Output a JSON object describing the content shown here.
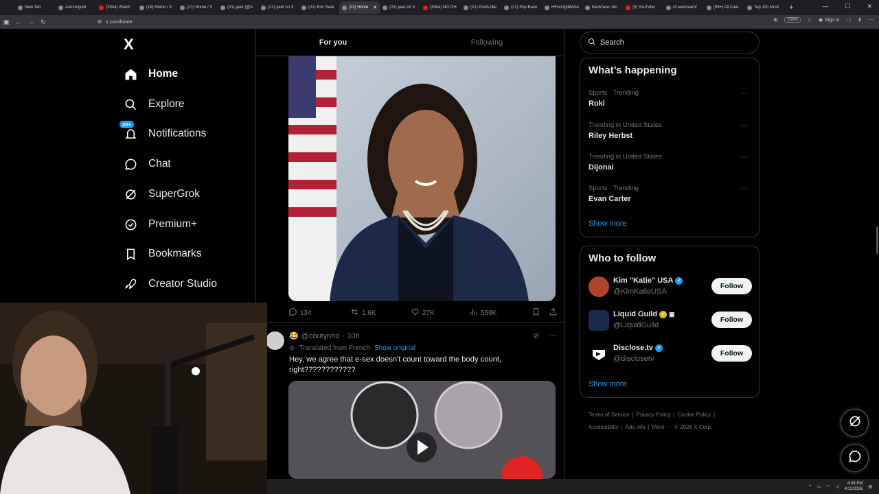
{
  "browser": {
    "tabs": [
      {
        "label": "New Tab"
      },
      {
        "label": "Asmongold"
      },
      {
        "label": "(3944) Watch"
      },
      {
        "label": "(19) Home / X"
      },
      {
        "label": "(21) Home / X"
      },
      {
        "label": "(21) yeet (@A"
      },
      {
        "label": "(21) yeet on X"
      },
      {
        "label": "(21) Eric Swal"
      },
      {
        "label": "(21) Home",
        "active": true
      },
      {
        "label": "(21) yeet on X"
      },
      {
        "label": "(3944) NO OH"
      },
      {
        "label": "(21) Posts like"
      },
      {
        "label": "(21) Pop Base"
      },
      {
        "label": "HFscGgIbMAA"
      },
      {
        "label": "blackface min"
      },
      {
        "label": "(5) YouTube"
      },
      {
        "label": "r/Livestreamf"
      },
      {
        "label": "(99+) All Cate"
      },
      {
        "label": "Top 100 Most"
      }
    ],
    "new_tab": "+",
    "url": "x.com/home",
    "zoom": "150%",
    "sign_in": "Sign in"
  },
  "sidebar": {
    "logo": "X",
    "items": [
      {
        "label": "Home",
        "icon": "home-icon"
      },
      {
        "label": "Explore",
        "icon": "search-icon"
      },
      {
        "label": "Notifications",
        "icon": "bell-icon",
        "badge": "20+"
      },
      {
        "label": "Chat",
        "icon": "chat-icon"
      },
      {
        "label": "SuperGrok",
        "icon": "grok-icon"
      },
      {
        "label": "Premium+",
        "icon": "premium-icon"
      },
      {
        "label": "Bookmarks",
        "icon": "bookmark-icon"
      },
      {
        "label": "Creator Studio",
        "icon": "rocket-icon"
      }
    ]
  },
  "feed": {
    "tabs": [
      "For you",
      "Following"
    ],
    "post1": {
      "replies": "134",
      "reposts": "1.6K",
      "likes": "27K",
      "views": "559K"
    },
    "post2": {
      "handle": "@coutynho",
      "time": "· 10h",
      "translated": "Translated from French",
      "show_original": "Show original",
      "text": "Hey, we agree that e-sex doesn't count toward the body count, right????????????"
    }
  },
  "right": {
    "search_placeholder": "Search",
    "whats_happening": "What’s happening",
    "trends": [
      {
        "context": "Sports · Trending",
        "name": "Roki"
      },
      {
        "context": "Trending in United States",
        "name": "Riley Herbst"
      },
      {
        "context": "Trending in United States",
        "name": "Dijonai"
      },
      {
        "context": "Sports · Trending",
        "name": "Evan Carter"
      }
    ],
    "show_more": "Show more",
    "who_to_follow": "Who to follow",
    "follow_suggestions": [
      {
        "name": "Kim \"Katie\" USA",
        "handle": "@KimKatieUSA",
        "verified": "blue"
      },
      {
        "name": "Liquid Guild",
        "handle": "@LiquidGuild",
        "verified": "gold"
      },
      {
        "name": "Disclose.tv",
        "handle": "@disclosetv",
        "verified": "blue"
      }
    ],
    "follow_label": "Follow",
    "footer": [
      "Terms of Service",
      "|",
      "Privacy Policy",
      "|",
      "Cookie Policy",
      "|",
      "Accessibility",
      "|",
      "Ads info",
      "|",
      "More ···",
      "© 2026 X Corp."
    ]
  },
  "taskbar": {
    "time": "4:09 PM",
    "date": "4/12/2026"
  },
  "colors": {
    "accent": "#1d9bf0",
    "background": "#000000",
    "border": "#2f3336",
    "muted": "#71767b"
  }
}
